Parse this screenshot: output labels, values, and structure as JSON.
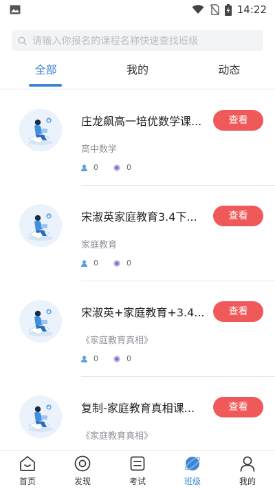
{
  "status_bar": {
    "time": "14:22",
    "icons": [
      "image-icon",
      "wifi-icon",
      "no-sim-icon",
      "battery-charging-icon"
    ]
  },
  "search": {
    "placeholder": "请输入你报名的课程名称快速查找班级"
  },
  "tabs": [
    {
      "label": "全部",
      "active": true
    },
    {
      "label": "我的",
      "active": false
    },
    {
      "label": "动态",
      "active": false
    }
  ],
  "courses": [
    {
      "title": "庄龙飙高一培优数学课...",
      "subtitle": "高中数学",
      "students": "0",
      "comments": "0",
      "button": "查看"
    },
    {
      "title": "宋淑英家庭教育3.4下...",
      "subtitle": "家庭教育",
      "students": "0",
      "comments": "0",
      "button": "查看"
    },
    {
      "title": "宋淑英+家庭教育+3.4...",
      "subtitle": "《家庭教育真相》",
      "students": "0",
      "comments": "0",
      "button": "查看"
    },
    {
      "title": "复制-家庭教育真相课...",
      "subtitle": "《家庭教育真相》",
      "students": "",
      "comments": "",
      "button": "查看"
    }
  ],
  "bottom_nav": [
    {
      "label": "首页",
      "icon": "home-icon",
      "active": false
    },
    {
      "label": "发现",
      "icon": "discover-icon",
      "active": false
    },
    {
      "label": "考试",
      "icon": "exam-icon",
      "active": false
    },
    {
      "label": "班级",
      "icon": "class-icon",
      "active": true
    },
    {
      "label": "我的",
      "icon": "profile-icon",
      "active": false
    }
  ],
  "colors": {
    "accent": "#3d86d6",
    "button": "#f0595a",
    "muted_text": "#8f939a"
  }
}
